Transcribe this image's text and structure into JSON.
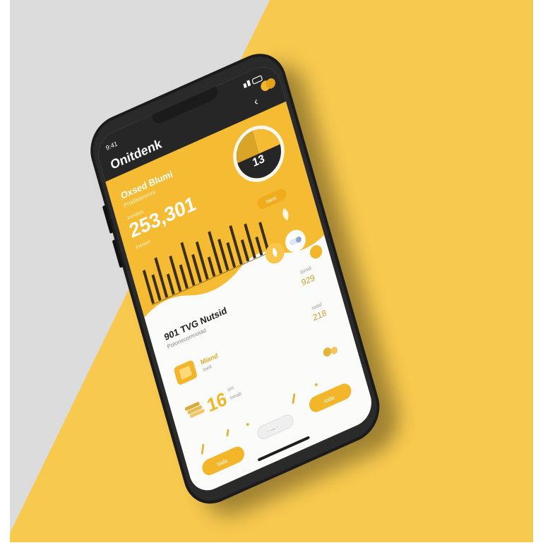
{
  "colors": {
    "backdrop_gray": "#dcdcdc",
    "backdrop_yellow": "#f7c94e",
    "phone_frame": "#1b1b1b",
    "screen_yellow": "#f4bb33",
    "screen_dark": "#262626",
    "card_white": "#fbfbfa",
    "accent": "#f3b52a"
  },
  "status_bar": {
    "time": "9:41",
    "indicators": "signal-wifi-battery"
  },
  "header": {
    "app_title": "Onitdenk",
    "back_icon": "chevron-left-icon",
    "avatar_icon": "avatar-coins-icon"
  },
  "summary": {
    "title": "Oxsed Blumi",
    "subtitle": "Prodisenwera",
    "caption": "Ioenlats",
    "value": "253,301",
    "note": "Ioenwn"
  },
  "dial": {
    "value": "13"
  },
  "pill_small_label": "Ioent",
  "bars": {
    "description_fn": "values",
    "values": [
      0.62,
      0.48,
      0.74,
      0.38,
      0.66,
      0.44,
      0.8,
      0.52,
      0.7,
      0.36,
      0.78,
      0.58,
      0.46,
      0.72,
      0.4,
      0.64,
      0.34,
      0.56
    ]
  },
  "card": {
    "title": "901 TVG Nutsid",
    "subtitle": "Potonecomnoiad",
    "right_top_label": "Iomid",
    "right_top_value": "929",
    "item_title": "Miand",
    "item_sub": "Ioeit",
    "right_mid_label": "Iodal",
    "right_mid_value": "218",
    "big_value": "16",
    "big_unit_top": "sm",
    "big_unit_bottom": "Ioeab"
  },
  "bottom": {
    "left_button": "Ioda",
    "center_button": "· — ·",
    "right_button": "Ioda"
  },
  "icons": [
    "chevron-left-icon",
    "avatar-coins-icon",
    "flame-icon",
    "toggle-icon",
    "coin-icon",
    "stack-icon",
    "sprout-icon",
    "bolt-icon",
    "drop-icon"
  ]
}
